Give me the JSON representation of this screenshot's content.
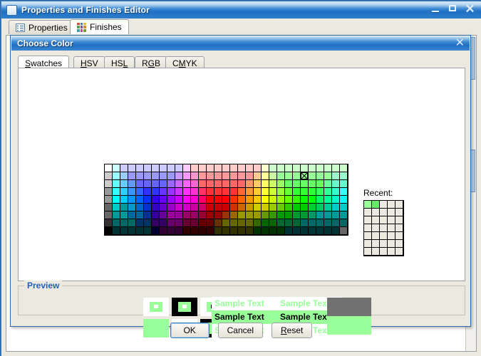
{
  "window": {
    "title": "Properties and Finishes Editor",
    "icon": "window-icon",
    "buttons": {
      "minimize": "minimize-icon",
      "maximize": "maximize-icon",
      "close": "✕"
    }
  },
  "tabs": [
    {
      "label": "Properties",
      "icon": "list-icon",
      "active": false
    },
    {
      "label": "Finishes",
      "icon": "color-grid-icon",
      "active": true
    }
  ],
  "dialog": {
    "title": "Choose Color",
    "close_label": "✕",
    "tabs": [
      {
        "label": "Swatches",
        "mnemonic": "S",
        "active": true
      },
      {
        "label": "HSV",
        "mnemonic": "H",
        "active": false
      },
      {
        "label": "HSL",
        "mnemonic": "L",
        "active": false
      },
      {
        "label": "RGB",
        "mnemonic": "G",
        "active": false
      },
      {
        "label": "CMYK",
        "mnemonic": "M",
        "active": false
      }
    ],
    "recent": {
      "label": "Recent:",
      "columns": 5,
      "rows": 7,
      "colors": [
        "#99ff99",
        "#66ee66"
      ]
    },
    "swatches": {
      "columns": 31,
      "rows": 9,
      "selected_row": 1,
      "selected_col": 25,
      "selected_color": "#99ff99"
    },
    "preview": {
      "legend": "Preview",
      "sample_text": "Sample Text",
      "selected_color": "#99ff99",
      "dark_block": "#717171",
      "text_rows": [
        {
          "fg": "#99ff99",
          "bg": "#ffffff"
        },
        {
          "fg": "#000000",
          "bg": "#99ff99"
        },
        {
          "fg": "#99ff99",
          "bg": "#ffffff"
        }
      ]
    },
    "buttons": [
      {
        "label": "OK",
        "mnemonic": "",
        "focused": true
      },
      {
        "label": "Cancel",
        "mnemonic": "",
        "focused": false
      },
      {
        "label": "Reset",
        "mnemonic": "R",
        "focused": false
      }
    ]
  },
  "colors": {
    "accent": "#2f6aa8",
    "titlebar": "#1f6fc4",
    "panel": "#ece9e0",
    "legend_text": "#1f5fbf"
  },
  "swatch_palette": [
    [
      "#ffffff",
      "#ccffff",
      "#ccccff",
      "#ccccff",
      "#ccccff",
      "#ccccff",
      "#ccccff",
      "#ccccff",
      "#ccccff",
      "#ccccff",
      "#ffccff",
      "#ffcccc",
      "#ffcccc",
      "#ffcccc",
      "#ffcccc",
      "#ffcccc",
      "#ffcccc",
      "#ffcccc",
      "#ffcccc",
      "#ffcccc",
      "#ffffcc",
      "#ccffcc",
      "#ccffcc",
      "#ccffcc",
      "#ccffcc",
      "#ccffcc",
      "#ccffcc",
      "#ccffcc",
      "#ccffcc",
      "#ccffcc",
      "#ccffcc"
    ],
    [
      "#cccccc",
      "#99ffff",
      "#99ccff",
      "#9999ff",
      "#9999ff",
      "#9999ff",
      "#9999ff",
      "#9999ff",
      "#9999ff",
      "#cc99ff",
      "#ff99ff",
      "#ff99cc",
      "#ff9999",
      "#ff9999",
      "#ff9999",
      "#ff9999",
      "#ff9999",
      "#ff9999",
      "#ff9999",
      "#ffcc99",
      "#ffff99",
      "#ccff99",
      "#99ff99",
      "#99ff99",
      "#99ff99",
      "#99ff99",
      "#99ff99",
      "#99ff99",
      "#99ff99",
      "#99ffcc",
      "#99ffcc"
    ],
    [
      "#cccccc",
      "#66ffff",
      "#66ccff",
      "#6699ff",
      "#6666ff",
      "#6666ff",
      "#6666ff",
      "#6666ff",
      "#9966ff",
      "#cc66ff",
      "#ff66ff",
      "#ff66cc",
      "#ff6666",
      "#ff6666",
      "#ff6666",
      "#ff6666",
      "#ff6666",
      "#ff6666",
      "#ff9966",
      "#ffcc66",
      "#ffff66",
      "#ccff66",
      "#99ff66",
      "#66ff66",
      "#66ff66",
      "#66ff66",
      "#66ff66",
      "#66ff66",
      "#66ff99",
      "#66ffcc",
      "#66ffcc"
    ],
    [
      "#999999",
      "#33ffff",
      "#33ccff",
      "#3399ff",
      "#3366ff",
      "#3333ff",
      "#3333ff",
      "#6633ff",
      "#9933ff",
      "#cc33ff",
      "#ff33ff",
      "#ff33cc",
      "#ff3366",
      "#ff3333",
      "#ff3333",
      "#ff3333",
      "#ff3333",
      "#ff6633",
      "#ff9933",
      "#ffcc33",
      "#ffff33",
      "#ccff33",
      "#99ff33",
      "#66ff33",
      "#33ff33",
      "#33ff33",
      "#33ff33",
      "#33ff66",
      "#33ff99",
      "#33ffcc",
      "#33ffff"
    ],
    [
      "#999999",
      "#00ffff",
      "#00ccff",
      "#0099ff",
      "#0066ff",
      "#0033ff",
      "#3300ff",
      "#6600ff",
      "#9900ff",
      "#cc00ff",
      "#ff00ff",
      "#ff00cc",
      "#ff0066",
      "#ff0000",
      "#ff0000",
      "#ff0000",
      "#ff3300",
      "#ff6600",
      "#ff9900",
      "#ffcc00",
      "#ffff00",
      "#ccff00",
      "#99ff00",
      "#66ff00",
      "#33ff00",
      "#00ff00",
      "#00ff00",
      "#00ff66",
      "#00ff99",
      "#00ffcc",
      "#00ffff"
    ],
    [
      "#666666",
      "#00cccc",
      "#009999",
      "#0099cc",
      "#0066cc",
      "#0033cc",
      "#3300cc",
      "#6600cc",
      "#9900cc",
      "#cc00cc",
      "#cc00cc",
      "#cc0099",
      "#cc0066",
      "#cc0000",
      "#cc0000",
      "#cc0000",
      "#cc3300",
      "#cc6600",
      "#cc9900",
      "#cccc00",
      "#cccc00",
      "#99cc00",
      "#66cc00",
      "#33cc00",
      "#00cc00",
      "#00cc00",
      "#00cc33",
      "#00cc66",
      "#00cc99",
      "#00cccc",
      "#00cccc"
    ],
    [
      "#666666",
      "#009999",
      "#009999",
      "#006699",
      "#006699",
      "#003399",
      "#330099",
      "#660099",
      "#990099",
      "#990099",
      "#990066",
      "#990066",
      "#990033",
      "#990000",
      "#990000",
      "#993300",
      "#996600",
      "#999900",
      "#999900",
      "#999900",
      "#669900",
      "#339900",
      "#009900",
      "#009900",
      "#009933",
      "#009933",
      "#009966",
      "#009999",
      "#009999",
      "#009999",
      "#009999"
    ],
    [
      "#333333",
      "#006666",
      "#006666",
      "#006666",
      "#003366",
      "#003366",
      "#330066",
      "#330066",
      "#660066",
      "#660066",
      "#660033",
      "#660033",
      "#660000",
      "#660000",
      "#663300",
      "#666600",
      "#666600",
      "#666600",
      "#666600",
      "#336600",
      "#006600",
      "#006600",
      "#006633",
      "#006633",
      "#006633",
      "#006666",
      "#006666",
      "#006666",
      "#006666",
      "#006666",
      "#006666"
    ],
    [
      "#000000",
      "#003333",
      "#003333",
      "#003333",
      "#003333",
      "#003333",
      "#000033",
      "#330033",
      "#330033",
      "#330033",
      "#330000",
      "#330000",
      "#330000",
      "#330000",
      "#333300",
      "#333300",
      "#333300",
      "#333300",
      "#333300",
      "#003300",
      "#003300",
      "#003300",
      "#003300",
      "#003333",
      "#003333",
      "#003333",
      "#003333",
      "#003333",
      "#003333",
      "#003333",
      "#666666"
    ]
  ],
  "icon_grid_colors": [
    "#d44b3a",
    "#4a7fc1",
    "#e0c040",
    "#5aa052",
    "#8050a8",
    "#e08a30",
    "#3a9fa8",
    "#c04a8a",
    "#7a9a3a"
  ]
}
